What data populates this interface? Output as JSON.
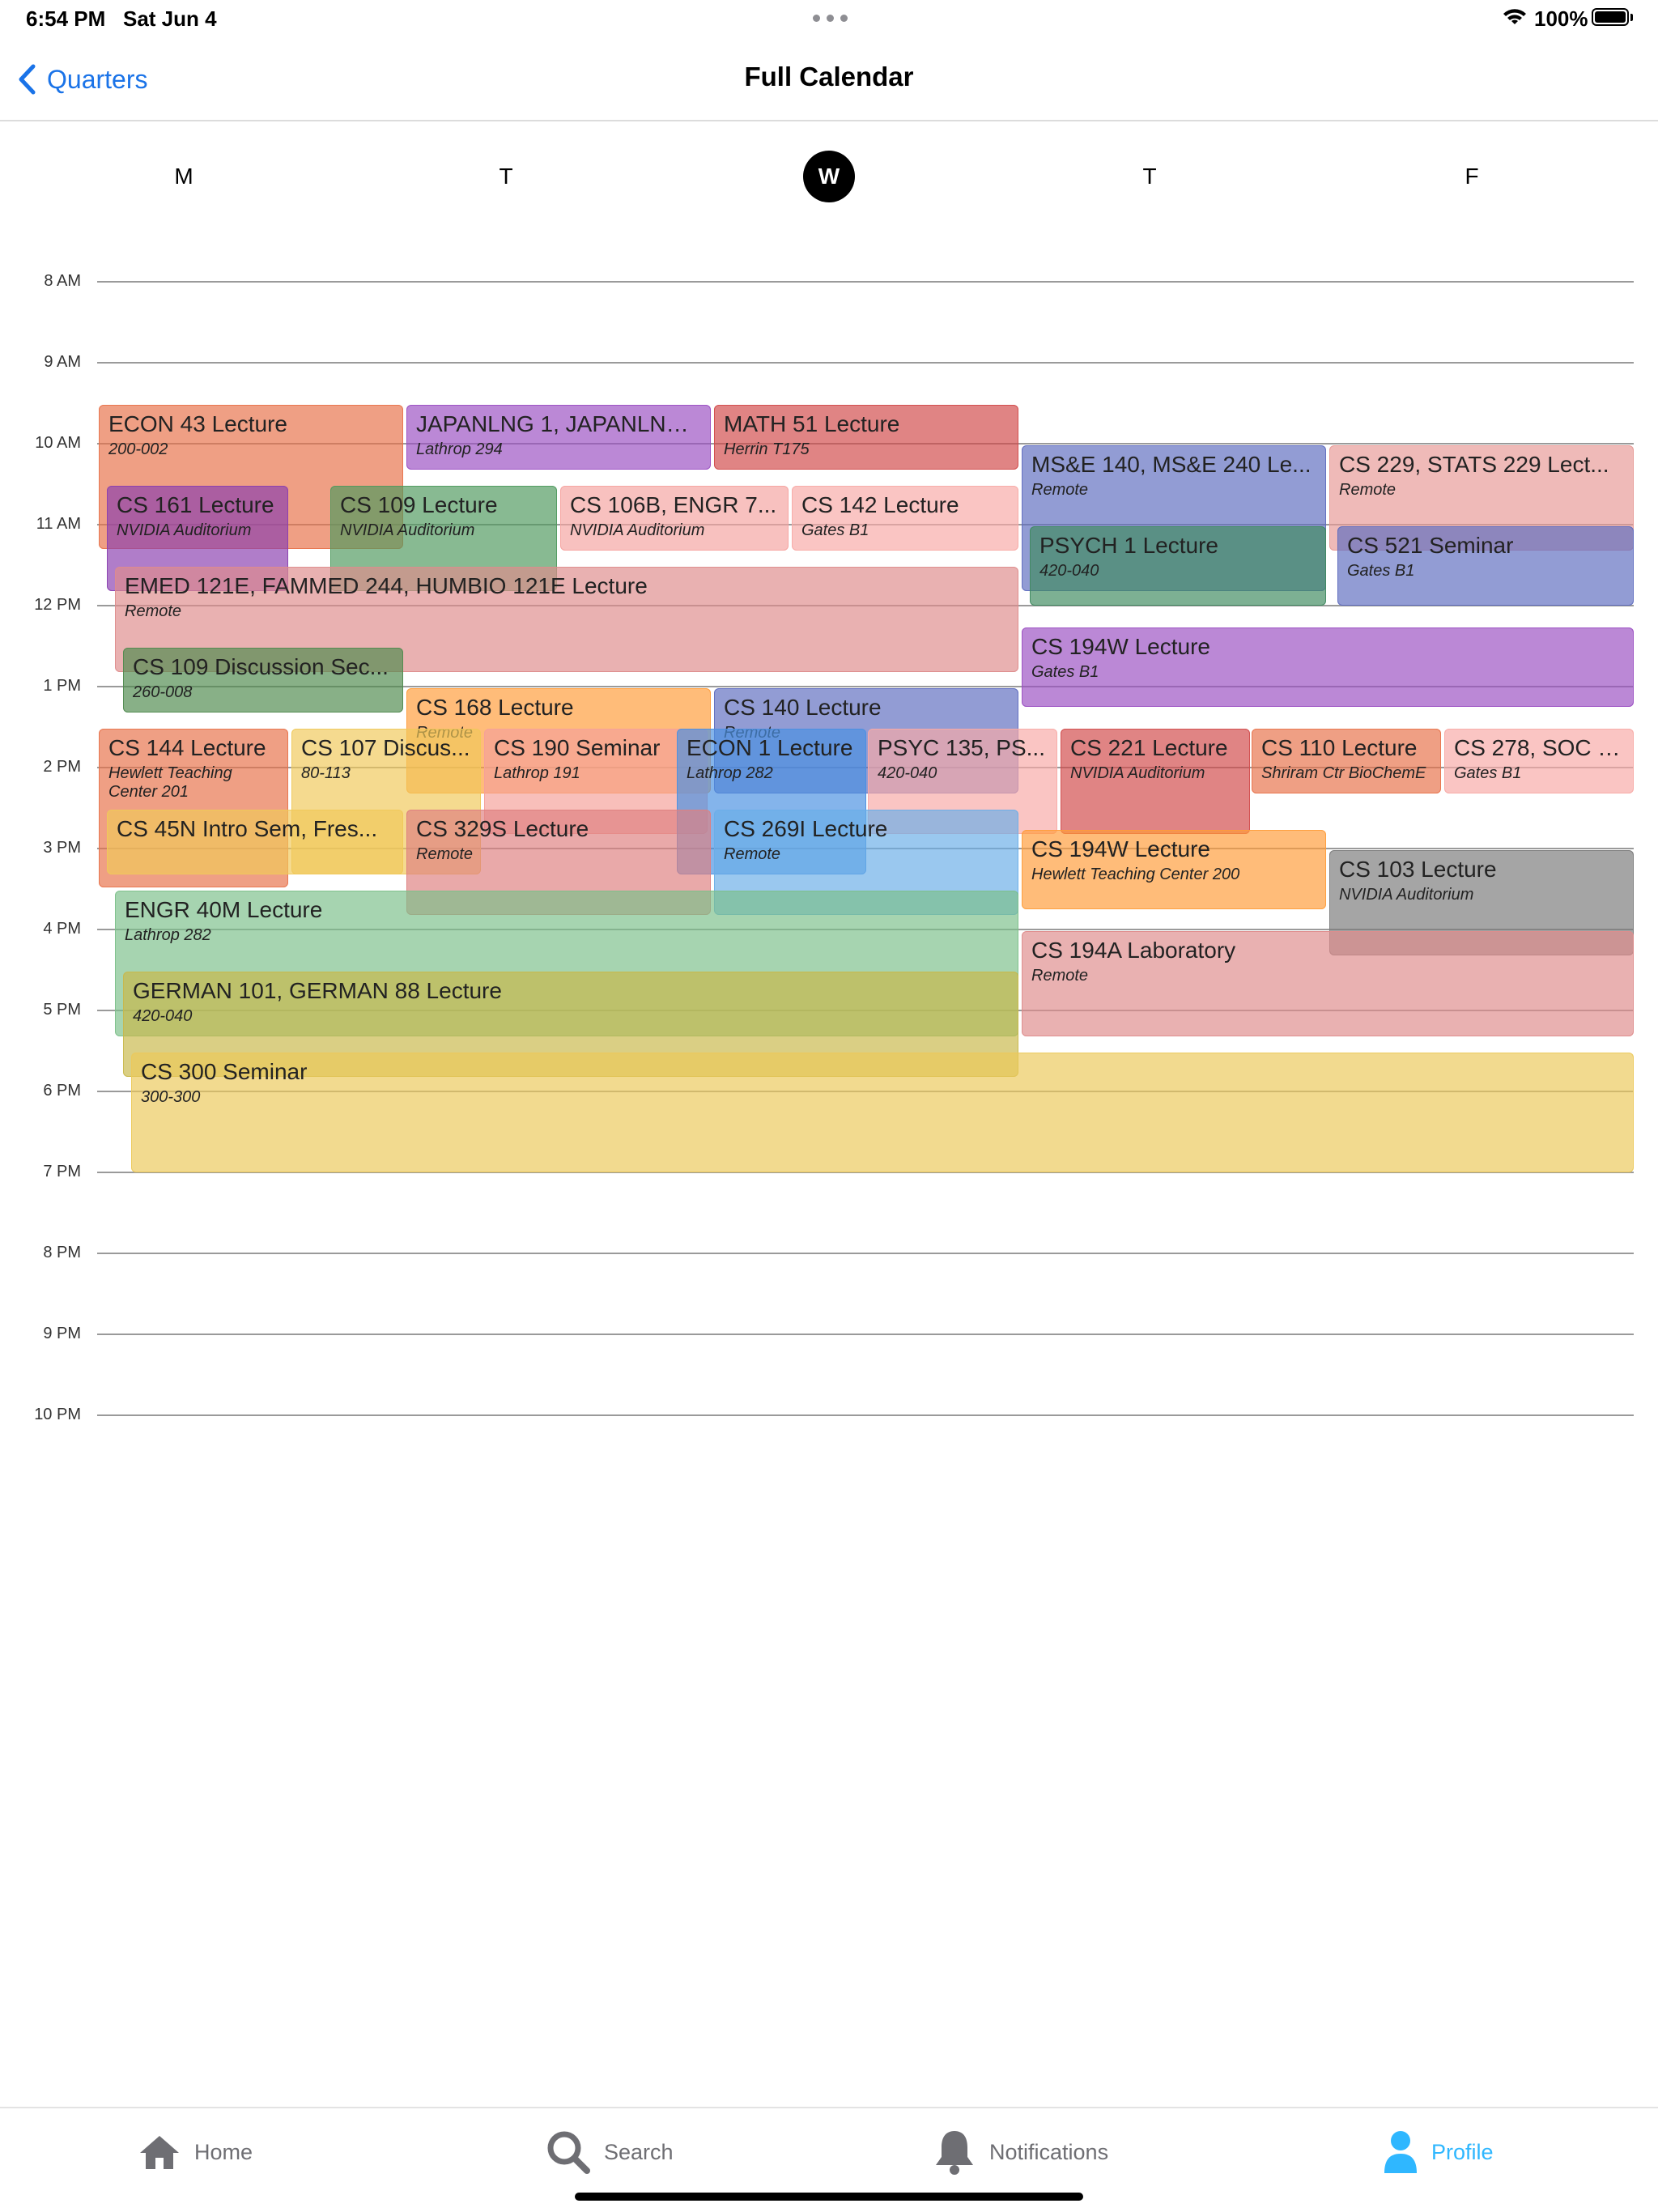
{
  "status_bar": {
    "time": "6:54 PM",
    "date": "Sat Jun 4",
    "battery": "100%"
  },
  "nav": {
    "back_label": "Quarters",
    "title": "Full Calendar"
  },
  "days": [
    {
      "label": "M",
      "selected": false
    },
    {
      "label": "T",
      "selected": false
    },
    {
      "label": "W",
      "selected": true
    },
    {
      "label": "T",
      "selected": false
    },
    {
      "label": "F",
      "selected": false
    }
  ],
  "hours": [
    "8 AM",
    "9 AM",
    "10 AM",
    "11 AM",
    "12 PM",
    "1 PM",
    "2 PM",
    "3 PM",
    "4 PM",
    "5 PM",
    "6 PM",
    "7 PM",
    "8 PM",
    "9 PM",
    "10 PM"
  ],
  "events": [
    {
      "title": "ECON 43 Lecture",
      "location": "200-002",
      "color": "#e8724a"
    },
    {
      "title": "JAPANLNG 1, JAPANLNG...",
      "location": "Lathrop 294",
      "color": "#9b4fc2"
    },
    {
      "title": "MATH 51 Lecture",
      "location": "Herrin T175",
      "color": "#d24a4a"
    },
    {
      "title": "MS&E 140, MS&E 240 Le...",
      "location": "Remote",
      "color": "#5f6dbf"
    },
    {
      "title": "CS 229, STATS 229 Lect...",
      "location": "Remote",
      "color": "#e79a96"
    },
    {
      "title": "CS 161 Lecture",
      "location": "NVIDIA Auditorium",
      "color": "#8a3fb0"
    },
    {
      "title": "CS 109 Lecture",
      "location": "NVIDIA Auditorium",
      "color": "#4f9a5e"
    },
    {
      "title": "CS 106B, ENGR 7...",
      "location": "NVIDIA Auditorium",
      "color": "#f5a3a0"
    },
    {
      "title": "CS 142 Lecture",
      "location": "Gates B1",
      "color": "#f7aaa6"
    },
    {
      "title": "PSYCH 1 Lecture",
      "location": "420-040",
      "color": "#3f8a60"
    },
    {
      "title": "CS 521 Seminar",
      "location": "Gates B1",
      "color": "#5f6dbf"
    },
    {
      "title": "EMED 121E, FAMMED 244, HUMBIO 121E Lecture",
      "location": "Remote",
      "color": "#de8c8c"
    },
    {
      "title": "CS 194W Lecture",
      "location": "Gates B1",
      "color": "#9b4fc2"
    },
    {
      "title": "CS 109 Discussion Sec...",
      "location": "260-008",
      "color": "#4f8a4e"
    },
    {
      "title": "CS 168 Lecture",
      "location": "Remote",
      "color": "#ff9c3a"
    },
    {
      "title": "CS 140 Lecture",
      "location": "Remote",
      "color": "#5f6dbf"
    },
    {
      "title": "CS 144 Lecture",
      "location": "Hewlett Teaching Center 201",
      "color": "#e8724a"
    },
    {
      "title": "CS 107 Discus...",
      "location": "80-113",
      "color": "#f0c95a"
    },
    {
      "title": "CS 190 Seminar",
      "location": "Lathrop 191",
      "color": "#f5a09a"
    },
    {
      "title": "ECON 1 Lecture",
      "location": "Lathrop 282",
      "color": "#4a90e2"
    },
    {
      "title": "PSYC 135, PS...",
      "location": "420-040",
      "color": "#f7aaa6"
    },
    {
      "title": "CS 221 Lecture",
      "location": "NVIDIA Auditorium",
      "color": "#d24a4a"
    },
    {
      "title": "CS 110 Lecture",
      "location": "Shriram Ctr BioChemE",
      "color": "#e8724a"
    },
    {
      "title": "CS 278, SOC 1...",
      "location": "Gates B1",
      "color": "#f7aaa6"
    },
    {
      "title": "CS 45N Intro Sem, Fres...",
      "location": "",
      "color": "#f0c95a"
    },
    {
      "title": "CS 329S Lecture",
      "location": "Remote",
      "color": "#de8080"
    },
    {
      "title": "CS 269I Lecture",
      "location": "Remote",
      "color": "#6aaee8"
    },
    {
      "title": "CS 194W Lecture",
      "location": "Hewlett Teaching Center 200",
      "color": "#ff9c3a"
    },
    {
      "title": "CS 103 Lecture",
      "location": "NVIDIA Auditorium",
      "color": "#7b7b7b"
    },
    {
      "title": "ENGR 40M Lecture",
      "location": "Lathrop 282",
      "color": "#7cc08a"
    },
    {
      "title": "CS 194A Laboratory",
      "location": "Remote",
      "color": "#de8c8c"
    },
    {
      "title": "GERMAN 101, GERMAN 88 Lecture",
      "location": "420-040",
      "color": "#c9b84a"
    },
    {
      "title": "CS 300 Seminar",
      "location": "300-300",
      "color": "#ecc95a"
    }
  ],
  "tabs": [
    {
      "label": "Home",
      "icon": "home-icon",
      "active": false
    },
    {
      "label": "Search",
      "icon": "search-icon",
      "active": false
    },
    {
      "label": "Notifications",
      "icon": "bell-icon",
      "active": false
    },
    {
      "label": "Profile",
      "icon": "person-icon",
      "active": true
    }
  ]
}
